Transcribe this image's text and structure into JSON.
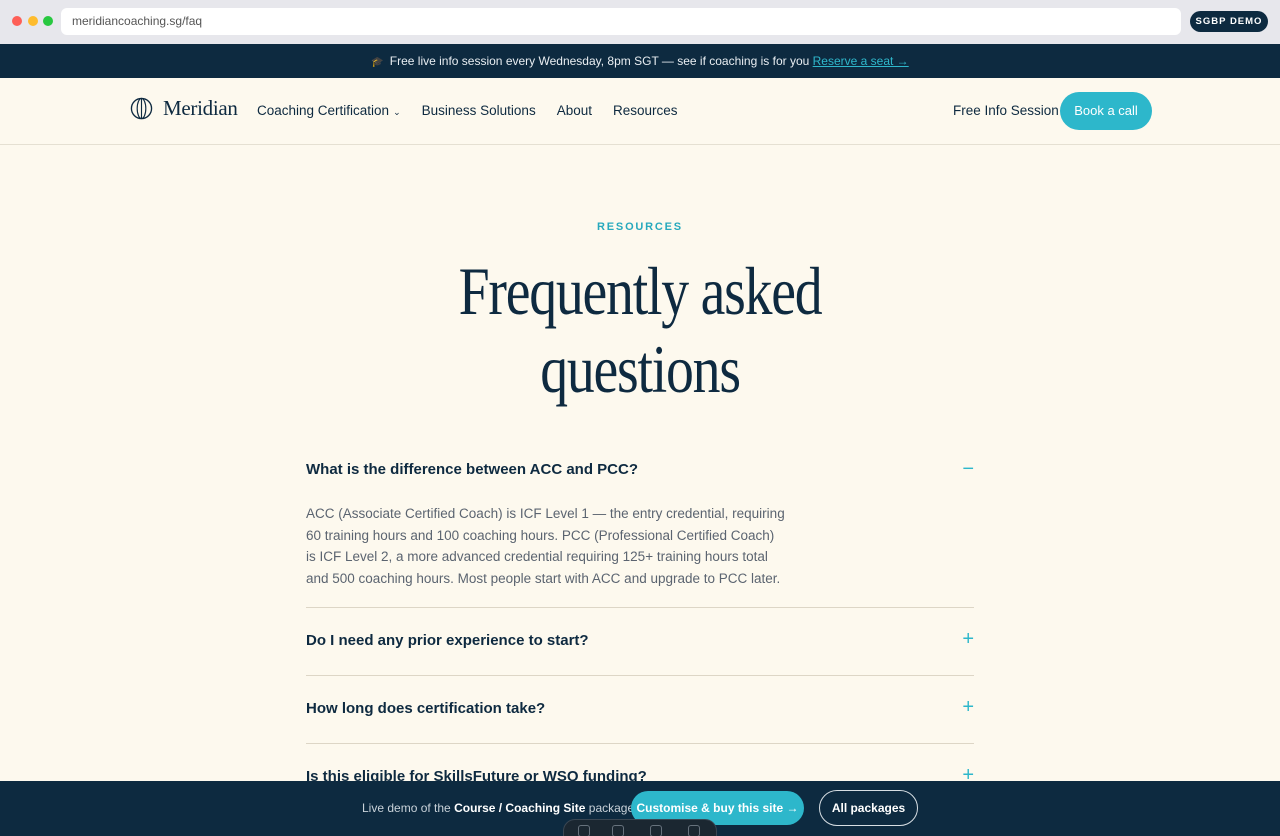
{
  "browser": {
    "url": "meridiancoaching.sg/faq",
    "badge": "SGBP DEMO"
  },
  "announcement": {
    "icon": "graduation-cap-icon",
    "text": "Free live info session every Wednesday, 8pm SGT — see if coaching is for you",
    "link": "Reserve a seat →"
  },
  "nav": {
    "brand": "Meridian",
    "links": [
      "Coaching Certification",
      "Business Solutions",
      "About",
      "Resources"
    ],
    "free_info": "Free Info Session",
    "cta": "Book a call"
  },
  "hero": {
    "eyebrow": "RESOURCES",
    "title": "Frequently asked questions"
  },
  "faq": [
    {
      "question": "What is the difference between ACC and PCC?",
      "answer": "ACC (Associate Certified Coach) is ICF Level 1 — the entry credential, requiring 60 training hours and 100 coaching hours. PCC (Professional Certified Coach) is ICF Level 2, a more advanced credential requiring 125+ training hours total and 500 coaching hours. Most people start with ACC and upgrade to PCC later.",
      "toggle": "−"
    },
    {
      "question": "Do I need any prior experience to start?",
      "toggle": "+"
    },
    {
      "question": "How long does certification take?",
      "toggle": "+"
    },
    {
      "question": "Is this eligible for SkillsFuture or WSQ funding?",
      "toggle": "+"
    }
  ],
  "bottom_bar": {
    "prefix": "Live demo of the",
    "package": "Course / Coaching Site",
    "suffix": "package.",
    "buy": "Customise & buy this site →",
    "all": "All packages"
  },
  "colors": {
    "navy": "#0d2a40",
    "accent": "#2db7cb",
    "cream": "#fdf9ee"
  }
}
